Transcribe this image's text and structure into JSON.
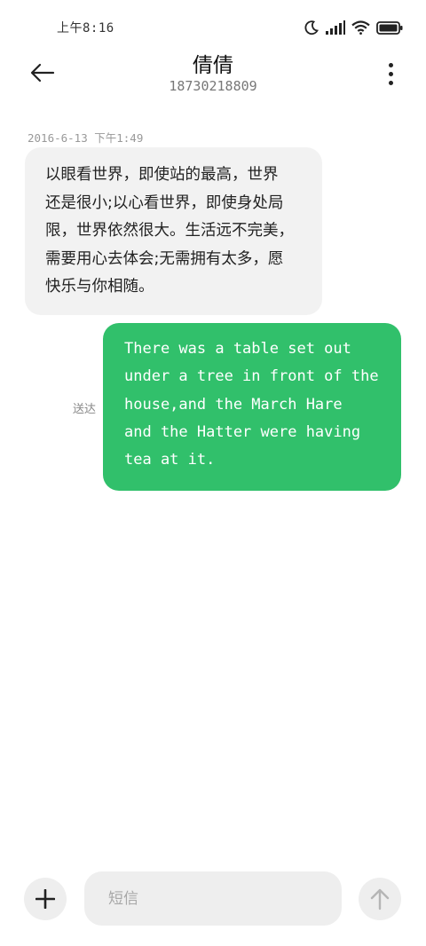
{
  "status_bar": {
    "time": "上午8:16",
    "icons": [
      "moon-icon",
      "signal-icon",
      "wifi-icon",
      "battery-icon"
    ]
  },
  "header": {
    "contact_name": "倩倩",
    "contact_number": "18730218809",
    "icons": [
      "back-arrow-icon",
      "more-vertical-icon"
    ]
  },
  "messages": [
    {
      "timestamp": "2016-6-13 下午1:49",
      "direction": "incoming",
      "lines": [
        "以眼看世界，即使站的最高，世界",
        "还是很小;以心看世界，即使身处局",
        "限，世界依然很大。生活远不完美，",
        "需要用心去体会;无需拥有太多，愿",
        "快乐与你相随。"
      ]
    },
    {
      "direction": "outgoing",
      "status": "送达",
      "lines": [
        "There was a table set out",
        "under a tree in front of the",
        "house,and the March Hare",
        "and the Hatter were having",
        "tea at it."
      ]
    }
  ],
  "composer": {
    "placeholder": "短信",
    "icons": [
      "plus-icon",
      "send-arrow-icon"
    ]
  },
  "colors": {
    "outgoing_bubble": "#31c06b",
    "incoming_bubble": "#f2f2f2",
    "control_background": "#eeeeee"
  }
}
